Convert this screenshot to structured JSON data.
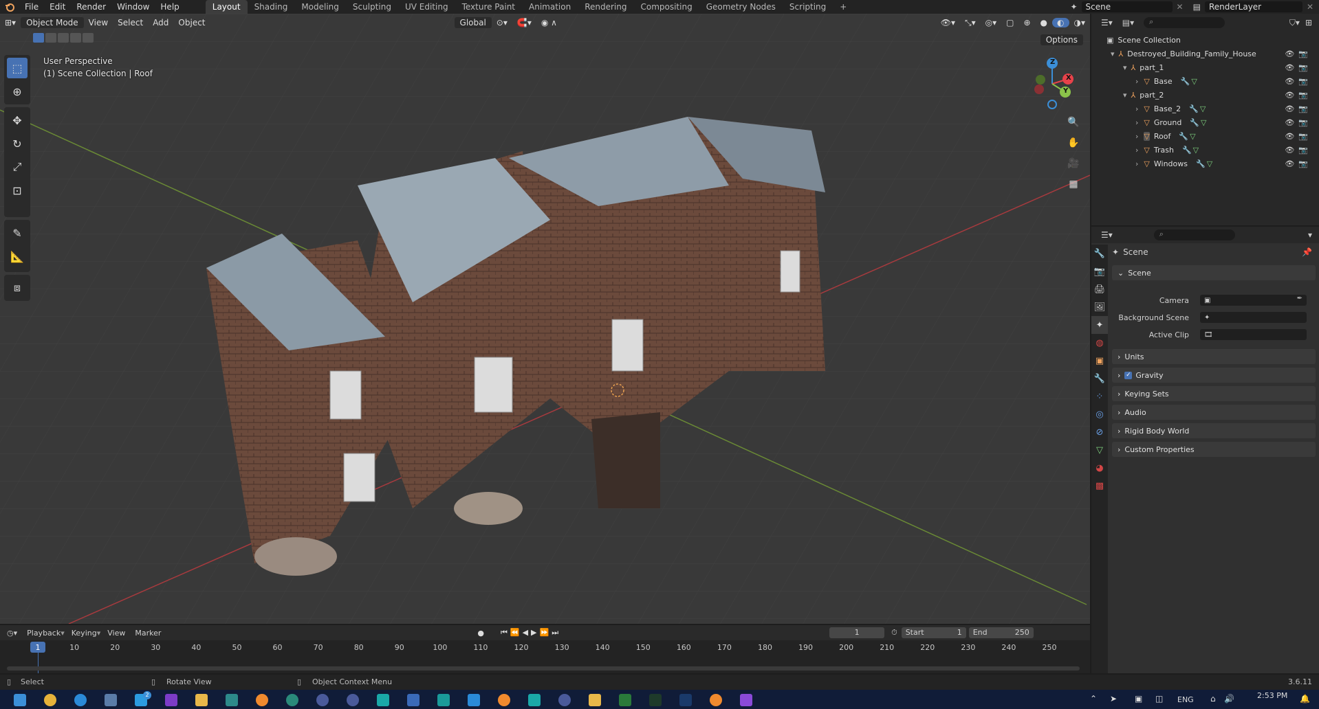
{
  "menu": {
    "file": "File",
    "edit": "Edit",
    "render": "Render",
    "window": "Window",
    "help": "Help"
  },
  "workspaces": [
    "Layout",
    "Shading",
    "Modeling",
    "Sculpting",
    "UV Editing",
    "Texture Paint",
    "Animation",
    "Rendering",
    "Compositing",
    "Geometry Nodes",
    "Scripting"
  ],
  "top_right": {
    "scene": "Scene",
    "layer": "RenderLayer"
  },
  "viewport": {
    "mode": "Object Mode",
    "view": "View",
    "select": "Select",
    "add": "Add",
    "object": "Object",
    "orientation": "Global",
    "options": "Options",
    "overlay_line1": "User Perspective",
    "overlay_line2": "(1) Scene Collection | Roof",
    "gizmo": {
      "x": "X",
      "y": "Y",
      "z": "Z"
    }
  },
  "outliner": {
    "root": "Scene Collection",
    "collection": "Destroyed_Building_Family_House",
    "part1": "part_1",
    "base": "Base",
    "part2": "part_2",
    "base2": "Base_2",
    "ground": "Ground",
    "roof": "Roof",
    "trash": "Trash",
    "windows": "Windows"
  },
  "properties": {
    "header": "Scene",
    "panel_scene": "Scene",
    "camera": "Camera",
    "background_scene": "Background Scene",
    "active_clip": "Active Clip",
    "units": "Units",
    "gravity": "Gravity",
    "keying_sets": "Keying Sets",
    "audio": "Audio",
    "rigid_body": "Rigid Body World",
    "custom_props": "Custom Properties"
  },
  "timeline": {
    "playback": "Playback",
    "keying": "Keying",
    "view": "View",
    "marker": "Marker",
    "current_frame": "1",
    "start_label": "Start",
    "start": "1",
    "end_label": "End",
    "end": "250",
    "ruler": [
      "1",
      "10",
      "20",
      "30",
      "40",
      "50",
      "60",
      "70",
      "80",
      "90",
      "100",
      "110",
      "120",
      "130",
      "140",
      "150",
      "160",
      "170",
      "180",
      "190",
      "200",
      "210",
      "220",
      "230",
      "240",
      "250"
    ]
  },
  "status": {
    "select": "Select",
    "rotate": "Rotate View",
    "context": "Object Context Menu",
    "version": "3.6.11"
  },
  "taskbar": {
    "lang": "ENG",
    "time": "2:53 PM",
    "badge": "2"
  },
  "colors": {
    "accent": "#4772b3",
    "selected_row": "#334d80",
    "x_axis": "#e8424a",
    "y_axis": "#8bc34a",
    "z_axis": "#3b8fd8",
    "object_icon": "#f0a35e",
    "modifier_icon": "#6aa0e8",
    "mesh_icon": "#7ed07e"
  }
}
